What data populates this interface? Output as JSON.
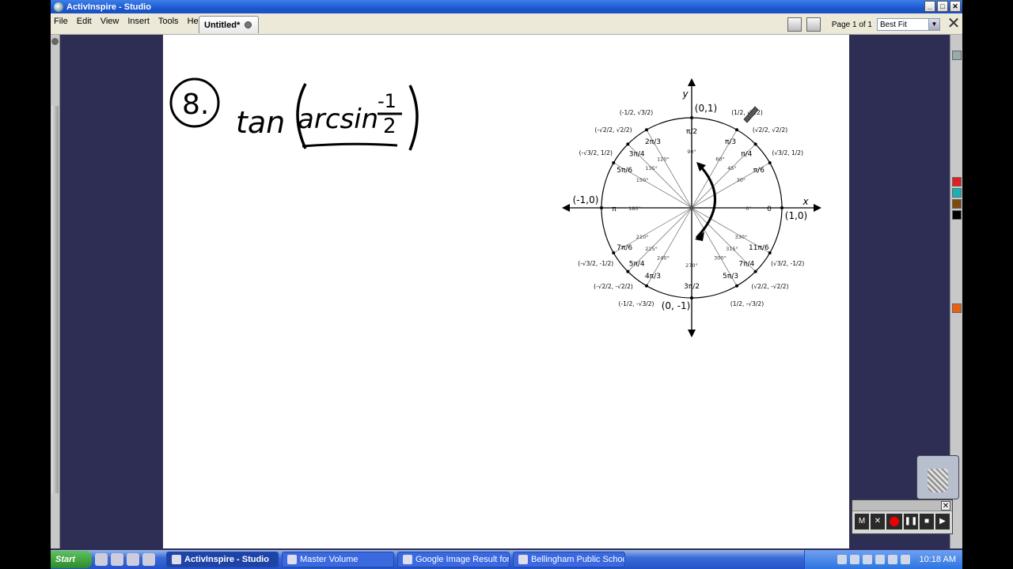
{
  "window": {
    "title": "ActivInspire - Studio",
    "controls": [
      "_",
      "□",
      "✕"
    ]
  },
  "menu": {
    "items": [
      "File",
      "Edit",
      "View",
      "Insert",
      "Tools",
      "Help"
    ]
  },
  "tab": {
    "label": "Untitled*"
  },
  "toolbar": {
    "page_label": "Page 1 of 1",
    "zoom_value": "Best Fit"
  },
  "canvas": {
    "problem_number": "8.",
    "expression": {
      "func": "tan",
      "inner": "arcsin",
      "numerator": "-1",
      "denominator": "2"
    },
    "unit_circle": {
      "axis_x": "x",
      "axis_y": "y",
      "points": {
        "top": "(0,1)",
        "left": "(-1,0)",
        "right": "(1,0)",
        "bottom": "(0, -1)"
      },
      "radians": {
        "r0": "0",
        "pi6": "π/6",
        "pi4": "π/4",
        "pi3": "π/3",
        "pi2": "π/2",
        "2pi3": "2π/3",
        "3pi4": "3π/4",
        "5pi6": "5π/6",
        "pi": "π",
        "7pi6": "7π/6",
        "5pi4": "5π/4",
        "4pi3": "4π/3",
        "3pi2": "3π/2",
        "5pi3": "5π/3",
        "7pi4": "7π/4",
        "11pi6": "11π/6"
      },
      "degrees": {
        "d0": "0°",
        "d30": "30°",
        "d45": "45°",
        "d60": "60°",
        "d90": "90°",
        "d120": "120°",
        "d135": "135°",
        "d150": "150°",
        "d180": "180°",
        "d210": "210°",
        "d225": "225°",
        "d240": "240°",
        "d270": "270°",
        "d300": "300°",
        "d315": "315°",
        "d330": "330°"
      },
      "coords": {
        "c30": "(√3/2, 1/2)",
        "c45": "(√2/2, √2/2)",
        "c60": "(1/2, √3/2)",
        "c120": "(-1/2, √3/2)",
        "c135": "(-√2/2, √2/2)",
        "c150": "(-√3/2, 1/2)",
        "c210": "(-√3/2, -1/2)",
        "c225": "(-√2/2, -√2/2)",
        "c240": "(-1/2, -√3/2)",
        "c300": "(1/2, -√3/2)",
        "c315": "(√2/2, -√2/2)",
        "c330": "(√3/2, -1/2)"
      }
    }
  },
  "recorder": {
    "buttons": [
      "M",
      "✕",
      "",
      "❚❚",
      "■",
      "▶"
    ]
  },
  "taskbar": {
    "start_label": "Start",
    "tasks": [
      "ActivInspire - Studio",
      "Master Volume",
      "Google Image Result for ...",
      "Bellingham Public Schools ..."
    ],
    "clock": "10:18 AM"
  }
}
